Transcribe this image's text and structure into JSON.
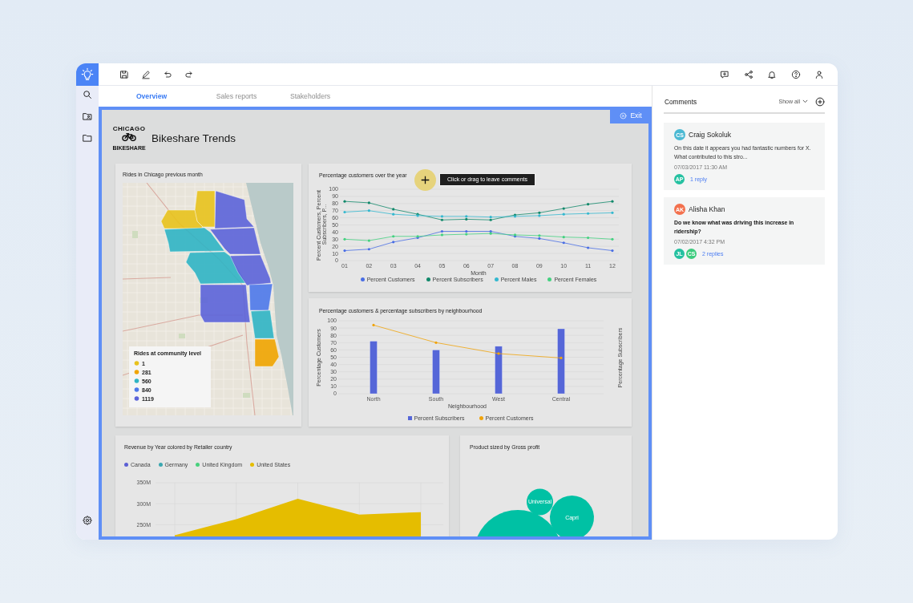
{
  "tabs": [
    {
      "label": "Overview",
      "selected": true
    },
    {
      "label": "Sales reports",
      "selected": false
    },
    {
      "label": "Stakeholders",
      "selected": false
    }
  ],
  "dashboard": {
    "logo": {
      "arc_text": "CHICAGO",
      "caption": "BIKESHARE"
    },
    "title": "Bikeshare Trends",
    "exit_button": {
      "label": "Exit"
    },
    "map_card": {
      "title": "Rides in Chicago previous month",
      "legend": {
        "title": "Rides at community level",
        "items": [
          {
            "label": "1",
            "color": "#e8c21c"
          },
          {
            "label": "281",
            "color": "#f0a400"
          },
          {
            "label": "560",
            "color": "#2fb4c4"
          },
          {
            "label": "840",
            "color": "#4d78ea"
          },
          {
            "label": "1119",
            "color": "#5b63d9"
          }
        ]
      }
    },
    "line_card": {
      "title": "Percentage customers over the year",
      "comment_cursor": {
        "tooltip": "Click or drag to leave comments"
      },
      "chart_data": {
        "type": "line",
        "xlabel": "Month",
        "ylabel": "Percent Customers, Percent Subscribers, P...",
        "categories": [
          "01",
          "02",
          "03",
          "04",
          "05",
          "06",
          "07",
          "08",
          "09",
          "10",
          "11",
          "12"
        ],
        "series": [
          {
            "name": "Percent Customers",
            "color": "#4a6ee4",
            "values": [
              14,
              16,
              26,
              32,
              41,
              41,
              41,
              34,
              31,
              25,
              18,
              14
            ]
          },
          {
            "name": "Percent Subscribers",
            "color": "#12896b",
            "values": [
              83,
              81,
              72,
              65,
              57,
              58,
              57,
              64,
              67,
              73,
              79,
              83
            ]
          },
          {
            "name": "Percent Males",
            "color": "#34b8cf",
            "values": [
              68,
              70,
              65,
              63,
              62,
              62,
              61,
              62,
              63,
              65,
              66,
              67
            ]
          },
          {
            "name": "Percent Females",
            "color": "#44d180",
            "values": [
              30,
              28,
              34,
              34,
              36,
              37,
              38,
              36,
              35,
              33,
              32,
              30
            ]
          }
        ],
        "ylim": [
          0,
          100
        ],
        "yticks": [
          0,
          10,
          20,
          30,
          40,
          50,
          60,
          70,
          80,
          90,
          100
        ],
        "grid": true,
        "legend": "bottom"
      }
    },
    "bar_card": {
      "title": "Percentage customers & percentage subscribers by neighbourhood",
      "chart_data": {
        "type": "bar",
        "xlabel": "Neighbourhood",
        "ylabel": "Percentage Customers",
        "y2label": "Percentage Subscribers",
        "categories": [
          "North",
          "South",
          "West",
          "Central"
        ],
        "series": [
          {
            "name": "Percent Subscribers",
            "type": "bar",
            "color": "#5566d8",
            "values": [
              72,
              60,
              65,
              89
            ]
          },
          {
            "name": "Percent Customers",
            "type": "line",
            "color": "#f0a30a",
            "values": [
              94,
              70,
              55,
              49
            ]
          }
        ],
        "ylim": [
          0,
          100
        ],
        "yticks": [
          0,
          10,
          20,
          30,
          40,
          50,
          60,
          70,
          80,
          90,
          100
        ],
        "grid": true,
        "legend": "bottom"
      }
    },
    "revenue_card": {
      "title": "Revenue by Year colored by Retailer country",
      "chart_data": {
        "type": "area",
        "series": [
          {
            "name": "Canada",
            "color": "#5b5fd4",
            "values": [
              null,
              null,
              null,
              null,
              null
            ]
          },
          {
            "name": "Germany",
            "color": "#3ba7b0",
            "values": [
              null,
              null,
              null,
              null,
              null
            ]
          },
          {
            "name": "United Kingdom",
            "color": "#48d17d",
            "values": [
              null,
              null,
              null,
              null,
              null
            ]
          },
          {
            "name": "United States",
            "color": "#e5bd00",
            "values": [
              225,
              263,
              312,
              274,
              280
            ]
          }
        ],
        "ylim": [
          222,
          350
        ],
        "yticks": [
          {
            "value": 250,
            "label": "250M"
          },
          {
            "value": 300,
            "label": "300M"
          },
          {
            "value": 350,
            "label": "350M"
          }
        ],
        "grid": true,
        "legend": "top"
      }
    },
    "product_card": {
      "title": "Product sized by Gross profit",
      "bubbles": [
        "Universal",
        "Capri"
      ]
    }
  },
  "comments_panel": {
    "title": "Comments",
    "filter": "Show all",
    "comments": [
      {
        "initials": "CS",
        "color": "#4bb9d3",
        "author": "Craig Sokoluk",
        "text": "On this date it appears you had fantastic numbers for X. What contributed to this stro...",
        "unread": false,
        "time": "07/03/2017 11:30 AM",
        "repliers": [
          {
            "initials": "AP",
            "color": "#25c1a1"
          }
        ],
        "replies": "1 reply"
      },
      {
        "initials": "AK",
        "color": "#f3714e",
        "author": "Alisha Khan",
        "text": "Do we know what was driving this increase in ridership?",
        "unread": true,
        "time": "07/02/2017 4:32 PM",
        "repliers": [
          {
            "initials": "JL",
            "color": "#25c1a1"
          },
          {
            "initials": "CS",
            "color": "#3ccc7e"
          }
        ],
        "replies": "2 replies"
      }
    ]
  }
}
